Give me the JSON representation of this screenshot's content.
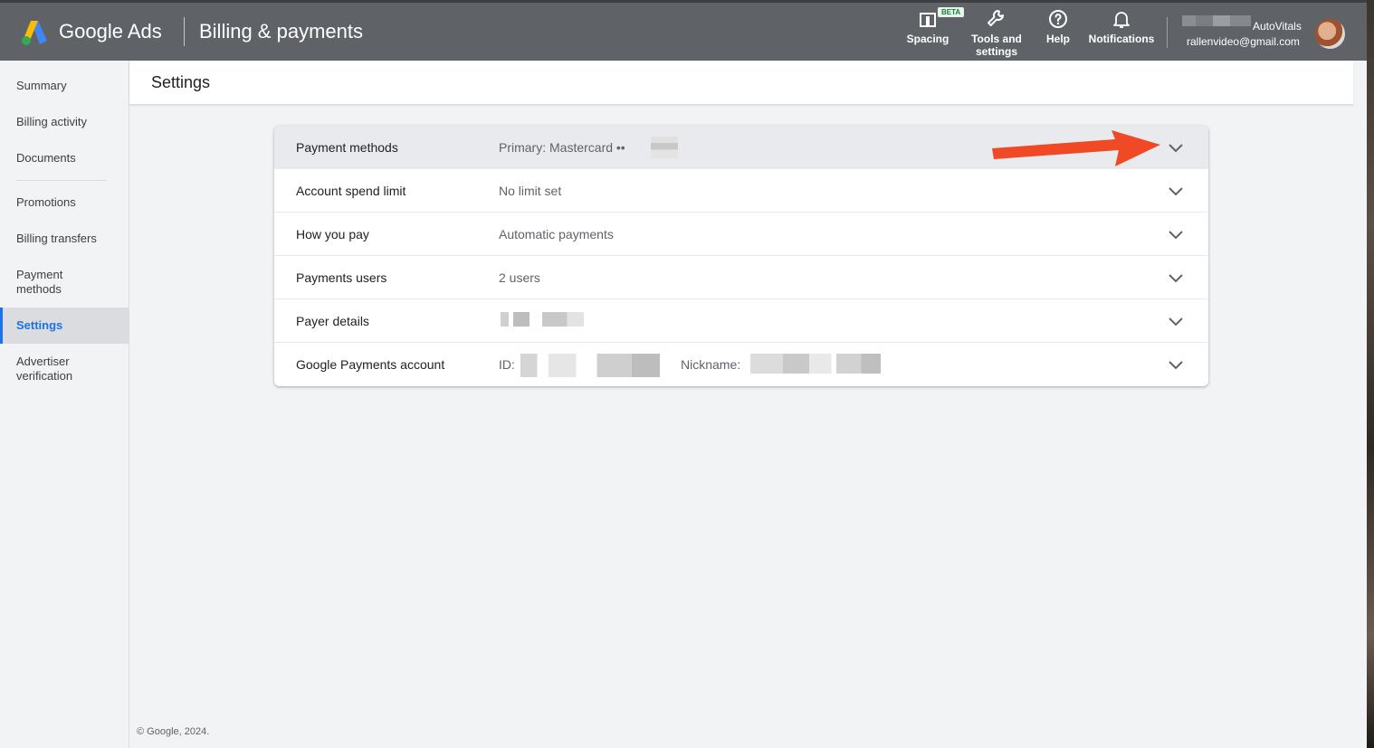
{
  "header": {
    "brand": "Google Ads",
    "section": "Billing & payments",
    "tools": {
      "spacing": "Spacing",
      "spacing_badge": "BETA",
      "tools_line1": "Tools and",
      "tools_line2": "settings",
      "help": "Help",
      "notifications": "Notifications"
    },
    "account": {
      "name": "AutoVitals",
      "email": "rallenvideo@gmail.com"
    }
  },
  "sidebar": {
    "items": [
      {
        "label": "Summary"
      },
      {
        "label": "Billing activity"
      },
      {
        "label": "Documents"
      },
      {
        "label": "Promotions"
      },
      {
        "label": "Billing transfers"
      },
      {
        "label": "Payment methods"
      },
      {
        "label": "Settings"
      },
      {
        "label": "Advertiser verification"
      }
    ],
    "active": "Settings"
  },
  "page": {
    "title": "Settings"
  },
  "settings_rows": [
    {
      "label": "Payment methods",
      "value": "Primary: Mastercard ••"
    },
    {
      "label": "Account spend limit",
      "value": "No limit set"
    },
    {
      "label": "How you pay",
      "value": "Automatic payments"
    },
    {
      "label": "Payments users",
      "value": "2 users"
    },
    {
      "label": "Payer details",
      "value": ""
    },
    {
      "label": "Google Payments account",
      "value": "ID:",
      "nickname_label": "Nickname:"
    }
  ],
  "footer": "© Google, 2024.",
  "colors": {
    "topbar": "#5f6368",
    "accent": "#1a73e8",
    "annotation_arrow": "#ef4a25"
  }
}
